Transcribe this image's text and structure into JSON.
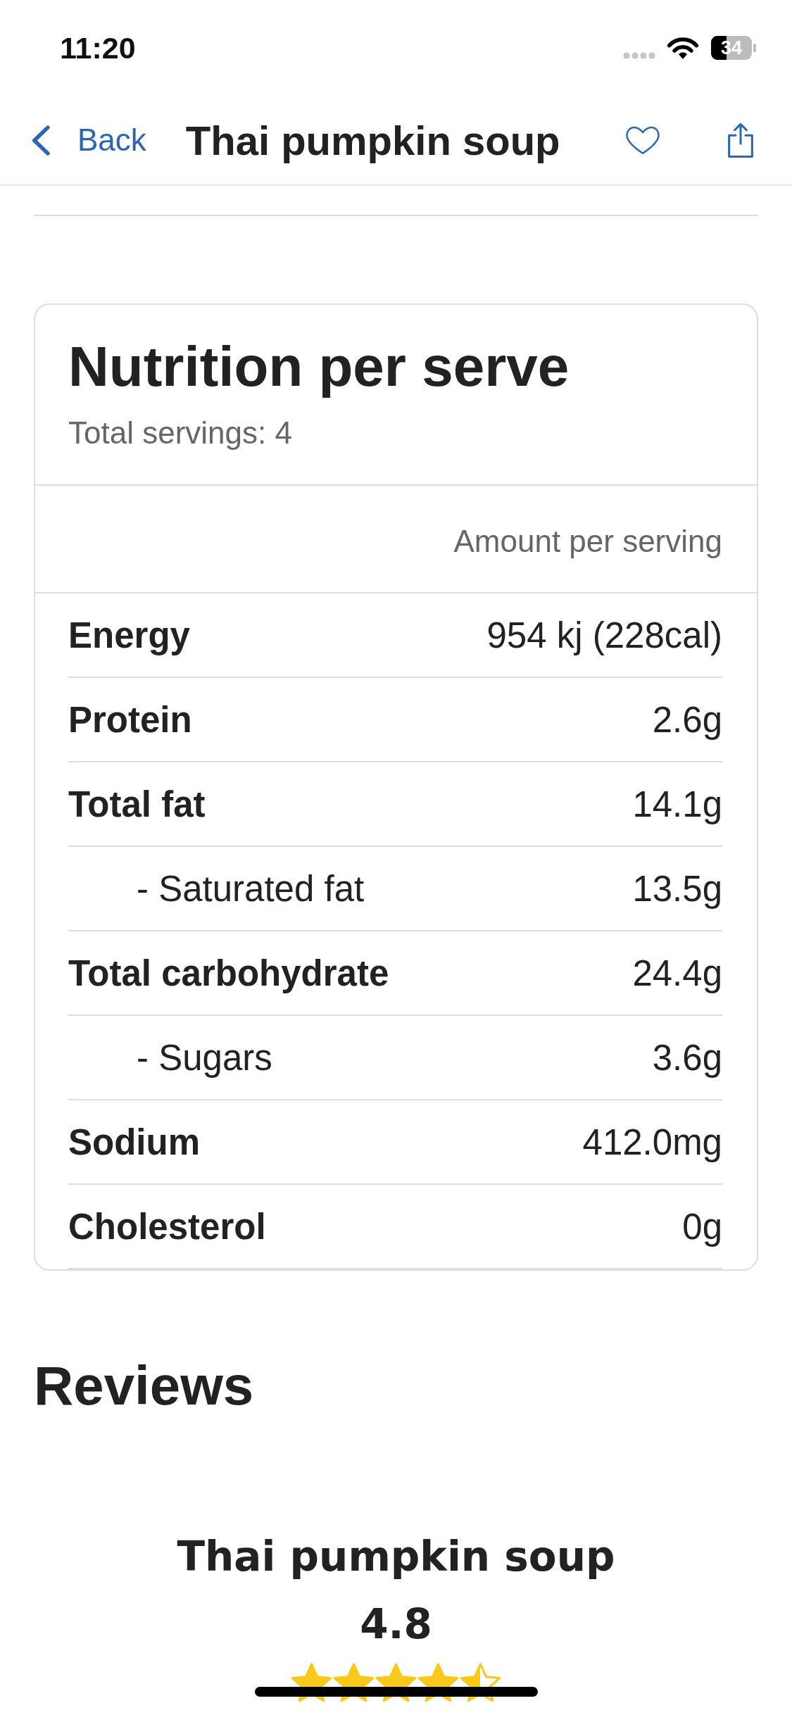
{
  "status_bar": {
    "time": "11:20",
    "battery": "34"
  },
  "nav": {
    "back": "Back",
    "title": "Thai pumpkin soup",
    "favorited": false
  },
  "nutrition": {
    "title": "Nutrition per serve",
    "servings": "Total servings: 4",
    "column_header": "Amount per serving",
    "rows": [
      {
        "kind": "main",
        "label": "Energy",
        "value": "954 kj (228cal)"
      },
      {
        "kind": "main",
        "label": "Protein",
        "value": "2.6g"
      },
      {
        "kind": "main",
        "label": "Total fat",
        "value": "14.1g"
      },
      {
        "kind": "sub",
        "label": "- Saturated fat",
        "value": "13.5g"
      },
      {
        "kind": "main",
        "label": "Total carbohydrate",
        "value": "24.4g"
      },
      {
        "kind": "sub",
        "label": "- Sugars",
        "value": "3.6g"
      },
      {
        "kind": "main",
        "label": "Sodium",
        "value": "412.0mg"
      },
      {
        "kind": "main",
        "label": "Cholesterol",
        "value": "0g"
      }
    ]
  },
  "reviews": {
    "title": "Reviews",
    "recipe": "Thai pumpkin soup",
    "rating": "4.8",
    "stars": 4.5
  }
}
